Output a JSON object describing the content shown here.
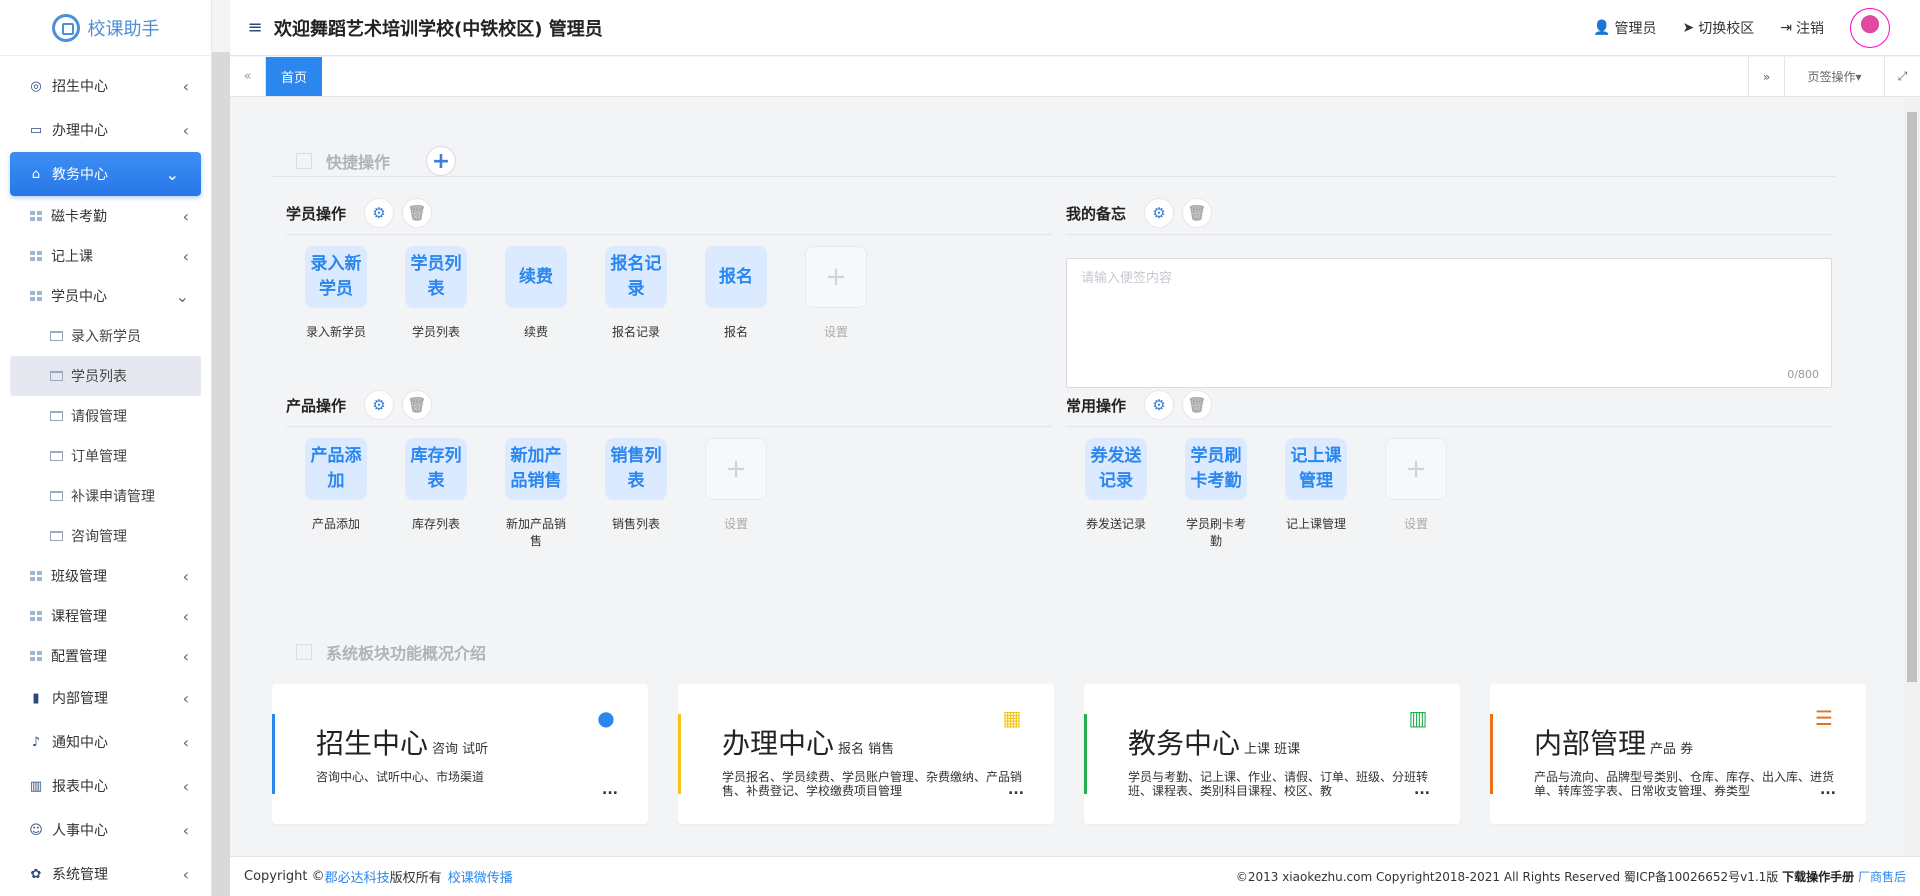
{
  "app": {
    "logo_text": "校课助手"
  },
  "header": {
    "welcome": "欢迎舞蹈艺术培训学校(中铁校区) 管理员",
    "user": "管理员",
    "switch_campus": "切换校区",
    "logout": "注销"
  },
  "tabs": {
    "home": "首页",
    "page_ops": "页签操作"
  },
  "sidebar": {
    "items": [
      {
        "label": "招生中心"
      },
      {
        "label": "办理中心"
      },
      {
        "label": "教务中心"
      },
      {
        "label": "磁卡考勤"
      },
      {
        "label": "记上课"
      },
      {
        "label": "学员中心"
      },
      {
        "label": "录入新学员"
      },
      {
        "label": "学员列表"
      },
      {
        "label": "请假管理"
      },
      {
        "label": "订单管理"
      },
      {
        "label": "补课申请管理"
      },
      {
        "label": "咨询管理"
      },
      {
        "label": "班级管理"
      },
      {
        "label": "课程管理"
      },
      {
        "label": "配置管理"
      },
      {
        "label": "内部管理"
      },
      {
        "label": "通知中心"
      },
      {
        "label": "报表中心"
      },
      {
        "label": "人事中心"
      },
      {
        "label": "系统管理"
      }
    ]
  },
  "quick": {
    "title": "快捷操作",
    "student_ops": {
      "title": "学员操作",
      "tiles": [
        {
          "icon_text": "录入新学员",
          "label": "录入新学员"
        },
        {
          "icon_text": "学员列表",
          "label": "学员列表"
        },
        {
          "icon_text": "续费",
          "label": "续费"
        },
        {
          "icon_text": "报名记录",
          "label": "报名记录"
        },
        {
          "icon_text": "报名",
          "label": "报名"
        },
        {
          "icon_text": "+",
          "label": "设置"
        }
      ]
    },
    "product_ops": {
      "title": "产品操作",
      "tiles": [
        {
          "icon_text": "产品添加",
          "label": "产品添加"
        },
        {
          "icon_text": "库存列表",
          "label": "库存列表"
        },
        {
          "icon_text": "新加产品销售",
          "label": "新加产品销售"
        },
        {
          "icon_text": "销售列表",
          "label": "销售列表"
        },
        {
          "icon_text": "+",
          "label": "设置"
        }
      ]
    },
    "memo": {
      "title": "我的备忘",
      "placeholder": "请输入便签内容",
      "counter": "0/800"
    },
    "common_ops": {
      "title": "常用操作",
      "tiles": [
        {
          "icon_text": "券发送记录",
          "label": "券发送记录"
        },
        {
          "icon_text": "学员刷卡考勤",
          "label": "学员刷卡考勤"
        },
        {
          "icon_text": "记上课管理",
          "label": "记上课管理"
        },
        {
          "icon_text": "+",
          "label": "设置"
        }
      ]
    }
  },
  "overview": {
    "title": "系统板块功能概况介绍",
    "cards": [
      {
        "title": "招生中心",
        "sub": "咨询 试听",
        "desc": "咨询中心、试听中心、市场渠道",
        "color": "#2b86ee",
        "icon": "user-icon"
      },
      {
        "title": "办理中心",
        "sub": "报名 销售",
        "desc": "学员报名、学员续费、学员账户管理、杂费缴纳、产品销售、补费登记、学校缴费项目管理",
        "color": "#f5c518",
        "icon": "building-icon"
      },
      {
        "title": "教务中心",
        "sub": "上课 班课",
        "desc": "学员与考勤、记上课、作业、请假、订单、班级、分班转班、课程表、类别科目课程、校区、教",
        "color": "#22b14c",
        "icon": "books-icon"
      },
      {
        "title": "内部管理",
        "sub": "产品 券",
        "desc": "产品与流向、品牌型号类别、仓库、库存、出入库、进货单、转库签字表、日常收支管理、券类型",
        "color": "#e8711a",
        "icon": "stack-icon"
      }
    ],
    "dots": "..."
  },
  "footer": {
    "copyright_prefix": "Copyright ©",
    "company": "郡必达科技",
    "rights": "版权所有",
    "brand": "校课微传播",
    "right_text": "©2013 xiaokezhu.com Copyright2018-2021 All Rights Reserved 蜀ICP备10026652号v1.1版",
    "manual": "下载操作手册",
    "after_sales": "厂商售后"
  }
}
